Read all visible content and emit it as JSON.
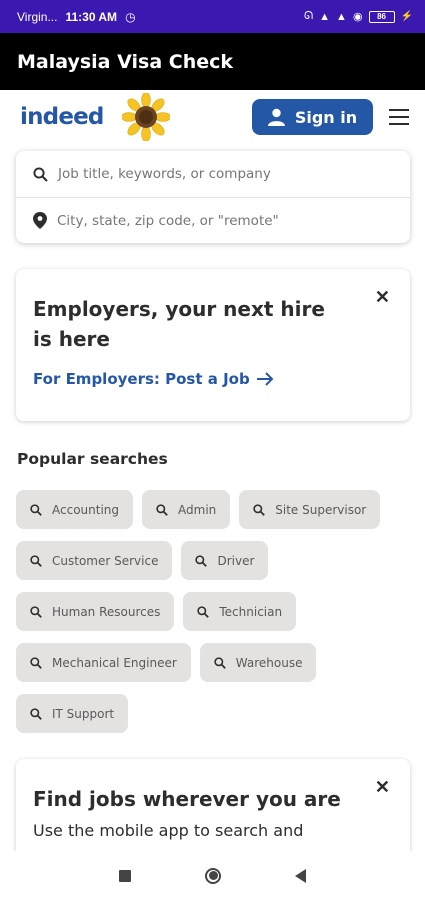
{
  "status": {
    "carrier": "Virgin...",
    "time": "11:30 AM",
    "battery": "86"
  },
  "app_title": "Malaysia Visa Check",
  "header": {
    "logo_text": "indeed",
    "signin_label": "Sign in"
  },
  "search": {
    "what_placeholder": "Job title, keywords, or company",
    "where_placeholder": "City, state, zip code, or \"remote\""
  },
  "employer_card": {
    "title": "Employers, your next hire is here",
    "link": "For Employers: Post a Job"
  },
  "popular": {
    "title": "Popular searches",
    "items": [
      "Accounting",
      "Admin",
      "Site Supervisor",
      "Customer Service",
      "Driver",
      "Human Resources",
      "Technician",
      "Mechanical Engineer",
      "Warehouse",
      "IT Support"
    ]
  },
  "app_card": {
    "title": "Find jobs wherever you are",
    "text": "Use the mobile app to search and"
  },
  "colors": {
    "brand": "#2557a7",
    "status_bar": "#3b19b0",
    "chip_bg": "#e4e2e0"
  }
}
